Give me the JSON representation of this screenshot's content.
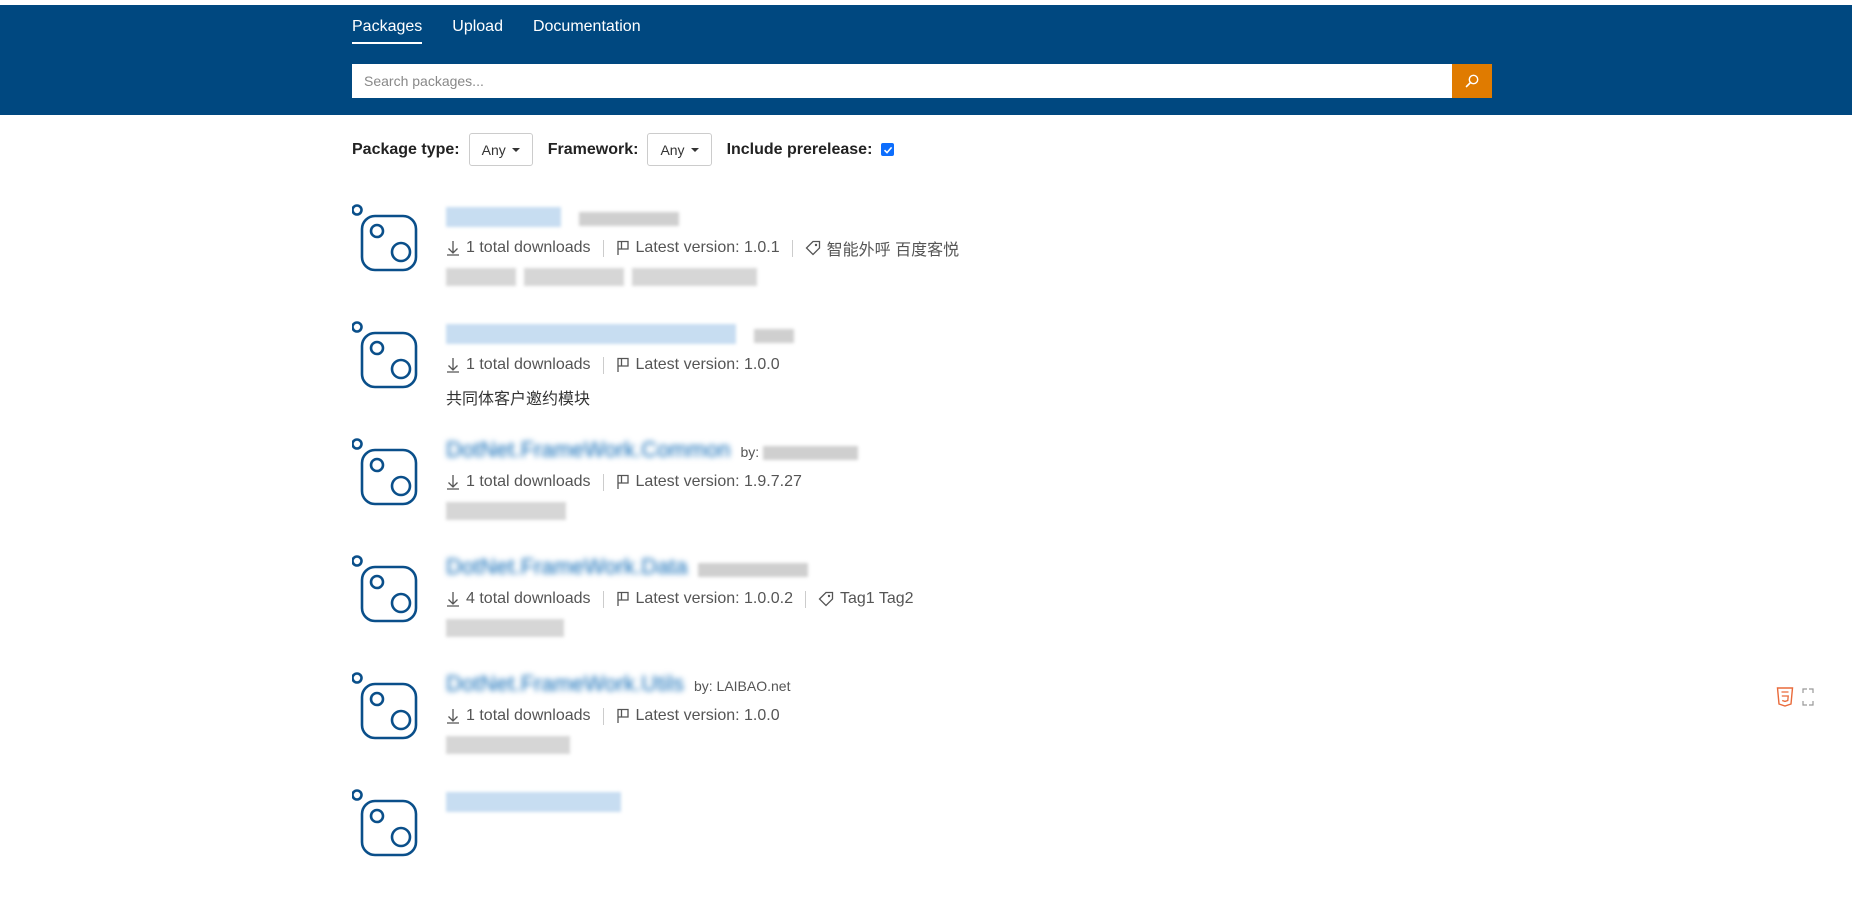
{
  "nav": {
    "items": [
      {
        "label": "Packages",
        "active": true
      },
      {
        "label": "Upload",
        "active": false
      },
      {
        "label": "Documentation",
        "active": false
      }
    ]
  },
  "search": {
    "placeholder": "Search packages...",
    "value": ""
  },
  "filters": {
    "package_type_label": "Package type:",
    "package_type_value": "Any",
    "framework_label": "Framework:",
    "framework_value": "Any",
    "prerelease_label": "Include prerelease:",
    "prerelease_checked": true
  },
  "packages": [
    {
      "title": "",
      "author": "",
      "downloads": "1 total downloads",
      "version": "Latest version: 1.0.1",
      "tags": "智能外呼 百度客悦",
      "description": ""
    },
    {
      "title": "",
      "author": "",
      "downloads": "1 total downloads",
      "version": "Latest version: 1.0.0",
      "tags": "",
      "description": "共同体客户邀约模块"
    },
    {
      "title": "DotNet.FrameWork.Common",
      "author": "by:",
      "downloads": "1 total downloads",
      "version": "Latest version: 1.9.7.27",
      "tags": "",
      "description": ""
    },
    {
      "title": "DotNet.FrameWork.Data",
      "author": "",
      "downloads": "4 total downloads",
      "version": "Latest version: 1.0.0.2",
      "tags": "Tag1 Tag2",
      "description": ""
    },
    {
      "title": "DotNet.FrameWork.Utils",
      "author": "by: LAIBAO.net",
      "downloads": "1 total downloads",
      "version": "Latest version: 1.0.0",
      "tags": "",
      "description": ""
    },
    {
      "title": "",
      "author": "",
      "downloads": "",
      "version": "",
      "tags": "",
      "description": ""
    }
  ],
  "colors": {
    "header_bg": "#004880",
    "search_button": "#e07b00",
    "title_link": "#0a68b5",
    "checkbox": "#0d6efd"
  }
}
